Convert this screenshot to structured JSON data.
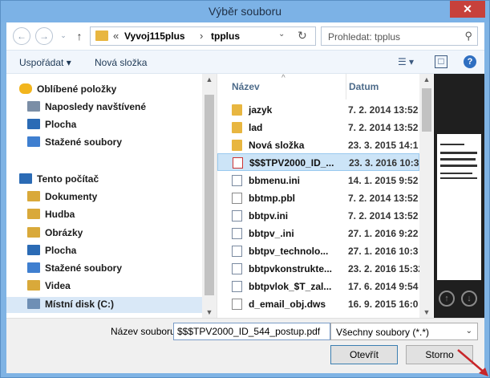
{
  "window": {
    "title": "Výběr souboru",
    "close_glyph": "✕"
  },
  "address": {
    "back_icon": "←",
    "forward_icon": "→",
    "up_icon": "↑",
    "crumb_prefix": "«",
    "crumbs": [
      "Vyvoj115plus",
      "tpplus"
    ],
    "separator": "›",
    "dropdown_icon": "⌄",
    "refresh_icon": "↻"
  },
  "search": {
    "placeholder": "Prohledat: tpplus",
    "icon": "⚲"
  },
  "toolbar": {
    "organize": "Uspořádat ▾",
    "new_folder": "Nová složka",
    "view_icon": "☰ ▾",
    "pane_icon": "□",
    "help_icon": "?"
  },
  "nav": {
    "items": [
      {
        "label": "Oblíbené položky",
        "icon": "star-icon",
        "color": "#f2b51d"
      },
      {
        "label": "Naposledy navštívené",
        "icon": "recent-icon",
        "color": "#7b8ea6"
      },
      {
        "label": "Plocha",
        "icon": "desktop-icon",
        "color": "#2b6bb5"
      },
      {
        "label": "Stažené soubory",
        "icon": "download-folder-icon",
        "color": "#3f7fd0"
      },
      {
        "label": "Tento počítač",
        "icon": "computer-icon",
        "color": "#2b6bb5"
      },
      {
        "label": "Dokumenty",
        "icon": "documents-icon",
        "color": "#d9a93a"
      },
      {
        "label": "Hudba",
        "icon": "music-icon",
        "color": "#d9a93a"
      },
      {
        "label": "Obrázky",
        "icon": "pictures-icon",
        "color": "#d9a93a"
      },
      {
        "label": "Plocha",
        "icon": "desktop-icon",
        "color": "#2b6bb5"
      },
      {
        "label": "Stažené soubory",
        "icon": "download-folder-icon",
        "color": "#3f7fd0"
      },
      {
        "label": "Videa",
        "icon": "videos-icon",
        "color": "#d9a93a"
      },
      {
        "label": "Místní disk (C:)",
        "icon": "drive-icon",
        "color": "#6f8fb5"
      }
    ]
  },
  "files": {
    "headers": {
      "name": "Název",
      "date": "Datum",
      "sort_caret": "^"
    },
    "rows": [
      {
        "name": "jazyk",
        "date": "7. 2. 2014 13:52",
        "kind": "folder"
      },
      {
        "name": "lad",
        "date": "7. 2. 2014 13:52",
        "kind": "folder"
      },
      {
        "name": "Nová složka",
        "date": "23. 3. 2015 14:1",
        "kind": "folder"
      },
      {
        "name": "$$$TPV2000_ID_...",
        "date": "23. 3. 2016 10:3",
        "kind": "pdf",
        "selected": true
      },
      {
        "name": "bbmenu.ini",
        "date": "14. 1. 2015 9:52",
        "kind": "cfg"
      },
      {
        "name": "bbtmp.pbl",
        "date": "7. 2. 2014 13:52",
        "kind": "file"
      },
      {
        "name": "bbtpv.ini",
        "date": "7. 2. 2014 13:52",
        "kind": "cfg"
      },
      {
        "name": "bbtpv_.ini",
        "date": "27. 1. 2016 9:22",
        "kind": "cfg"
      },
      {
        "name": "bbtpv_technolo...",
        "date": "27. 1. 2016 10:3",
        "kind": "cfg"
      },
      {
        "name": "bbtpvkonstrukte...",
        "date": "23. 2. 2016 15:32",
        "kind": "cfg"
      },
      {
        "name": "bbtpvlok_$T_zal...",
        "date": "17. 6. 2014 9:54",
        "kind": "cfg"
      },
      {
        "name": "d_email_obj.dws",
        "date": "16. 9. 2015 16:0",
        "kind": "file"
      }
    ]
  },
  "preview": {
    "up_icon": "↑",
    "down_icon": "↓"
  },
  "bottom": {
    "filename_label": "Název souboru:",
    "filename_value": "$$$TPV2000_ID_544_postup.pdf",
    "filetype_value": "Všechny soubory (*.*)",
    "filetype_caret": "⌄",
    "open_label": "Otevřít",
    "cancel_label": "Storno"
  }
}
